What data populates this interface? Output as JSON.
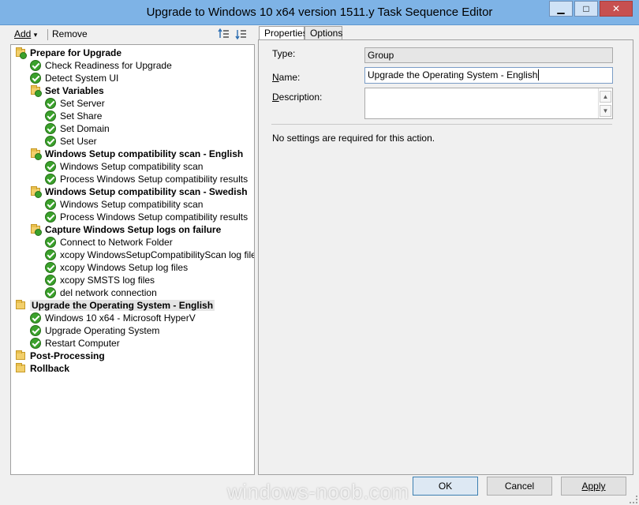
{
  "window": {
    "title": "Upgrade to Windows 10 x64 version 1511.y Task Sequence Editor",
    "minimize": "▁",
    "maximize": "□",
    "close": "✕"
  },
  "toolbar": {
    "add_label": "Add",
    "add_arrow": "▾",
    "remove_label": "Remove"
  },
  "tree": [
    {
      "label": "Prepare for Upgrade",
      "type": "group"
    },
    {
      "label": "Check Readiness for Upgrade",
      "type": "step"
    },
    {
      "label": "Detect System UI",
      "type": "step"
    },
    {
      "label": "Set Variables",
      "type": "group"
    },
    {
      "label": "Set Server",
      "type": "step"
    },
    {
      "label": "Set Share",
      "type": "step"
    },
    {
      "label": "Set Domain",
      "type": "step"
    },
    {
      "label": "Set User",
      "type": "step"
    },
    {
      "label": "Windows Setup compatibility scan - English",
      "type": "group"
    },
    {
      "label": "Windows Setup compatibility scan",
      "type": "step"
    },
    {
      "label": "Process Windows Setup compatibility results",
      "type": "step"
    },
    {
      "label": "Windows Setup compatibility scan - Swedish",
      "type": "group"
    },
    {
      "label": "Windows Setup compatibility scan",
      "type": "step"
    },
    {
      "label": "Process Windows Setup compatibility results",
      "type": "step"
    },
    {
      "label": "Capture Windows Setup logs on failure",
      "type": "group"
    },
    {
      "label": "Connect to Network Folder",
      "type": "step"
    },
    {
      "label": "xcopy WindowsSetupCompatibilityScan log file",
      "type": "step"
    },
    {
      "label": "xcopy Windows Setup log files",
      "type": "step"
    },
    {
      "label": "xcopy SMSTS log files",
      "type": "step"
    },
    {
      "label": "del network connection",
      "type": "step"
    },
    {
      "label": "Upgrade the Operating System - English",
      "type": "group",
      "selected": true
    },
    {
      "label": "Windows 10 x64 - Microsoft HyperV",
      "type": "step"
    },
    {
      "label": "Upgrade Operating System",
      "type": "step"
    },
    {
      "label": "Restart Computer",
      "type": "step"
    },
    {
      "label": "Post-Processing",
      "type": "group"
    },
    {
      "label": "Rollback",
      "type": "group"
    }
  ],
  "tabs": {
    "properties": "Properties",
    "options": "Options"
  },
  "properties": {
    "type_label": "Type:",
    "type_value": "Group",
    "name_label": "Name:",
    "name_value": "Upgrade the Operating System - English",
    "description_label": "Description:",
    "description_value": "",
    "info_text": "No settings are required  for this action."
  },
  "buttons": {
    "ok": "OK",
    "cancel": "Cancel",
    "apply": "Apply"
  },
  "watermark": "windows-noob.com"
}
